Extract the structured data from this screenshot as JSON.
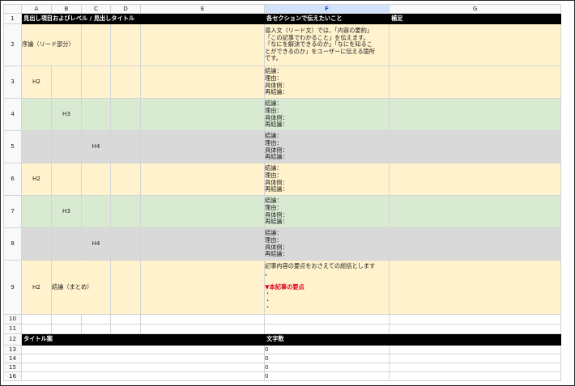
{
  "columns": [
    "A",
    "B",
    "C",
    "D",
    "E",
    "F",
    "G"
  ],
  "selected_column": "F",
  "row_numbers": [
    "1",
    "2",
    "3",
    "4",
    "5",
    "6",
    "7",
    "8",
    "9",
    "10",
    "11",
    "12",
    "13",
    "14",
    "15",
    "16"
  ],
  "header": {
    "col_a": "見出し項目およびレベル / 見出しタイトル",
    "col_f": "各セクションで伝えたいこと",
    "col_g": "補足"
  },
  "row2": {
    "a": "序論（リード部分）",
    "f": [
      "導入文（リード文）では、「内容の要約」",
      "「この記事でわかること」を伝えます。",
      "「なにを解決できるのか」「なにを知るこ",
      "とができるのか」をユーザーに伝える箇所",
      "です。"
    ]
  },
  "template_lines": [
    "結論：",
    "理由：",
    "具体例：",
    "再結論："
  ],
  "levels": {
    "h2": "H2",
    "h3": "H3",
    "h4": "H4"
  },
  "row9": {
    "a": "H2",
    "b": "結論（まとめ）",
    "f_line1": "記事内容の要点をおさえての総括とします",
    "f_line2": "。",
    "f_heading": "▼本記事の要点",
    "f_bullets": [
      "・",
      "・",
      "・"
    ]
  },
  "row12": {
    "col_a": "タイトル案",
    "col_f": "文字数"
  },
  "char_counts": [
    "0",
    "0",
    "0",
    "0"
  ]
}
